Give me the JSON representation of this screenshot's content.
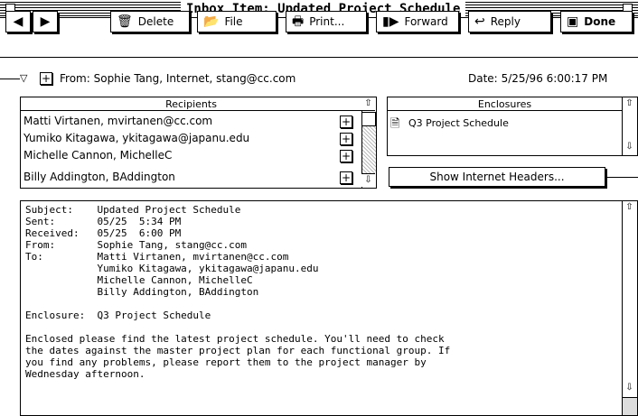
{
  "window": {
    "title": "Inbox Item: Updated Project Schedule"
  },
  "toolbar": {
    "delete_label": "Delete",
    "file_label": "File",
    "print_label": "Print...",
    "forward_label": "Forward",
    "reply_label": "Reply",
    "done_label": "Done"
  },
  "header": {
    "from_label": "From:",
    "from_value": "Sophie Tang, Internet, stang@cc.com",
    "date_label": "Date:",
    "date_value": "5/25/96 6:00:17 PM"
  },
  "recipients": {
    "title": "Recipients",
    "items": [
      {
        "label": "Matti Virtanen, mvirtanen@cc.com"
      },
      {
        "label": "Yumiko Kitagawa, ykitagawa@japanu.edu"
      },
      {
        "label": "Michelle Cannon, MichelleC"
      },
      {
        "label": "Billy Addington, BAddington"
      }
    ]
  },
  "enclosures": {
    "title": "Enclosures",
    "items": [
      {
        "label": "Q3 Project Schedule"
      }
    ],
    "show_headers_label": "Show Internet Headers..."
  },
  "message": {
    "lines": [
      "Subject:    Updated Project Schedule",
      "Sent:       05/25  5:34 PM",
      "Received:   05/25  6:00 PM",
      "From:       Sophie Tang, stang@cc.com",
      "To:         Matti Virtanen, mvirtanen@cc.com",
      "            Yumiko Kitagawa, ykitagawa@japanu.edu",
      "            Michelle Cannon, MichelleC",
      "            Billy Addington, BAddington",
      "",
      "Enclosure:  Q3 Project Schedule",
      "",
      "Enclosed please find the latest project schedule. You'll need to check",
      "the dates against the master project plan for each functional group. If",
      "you find any problems, please report them to the project manager by",
      "Wednesday afternoon."
    ]
  }
}
